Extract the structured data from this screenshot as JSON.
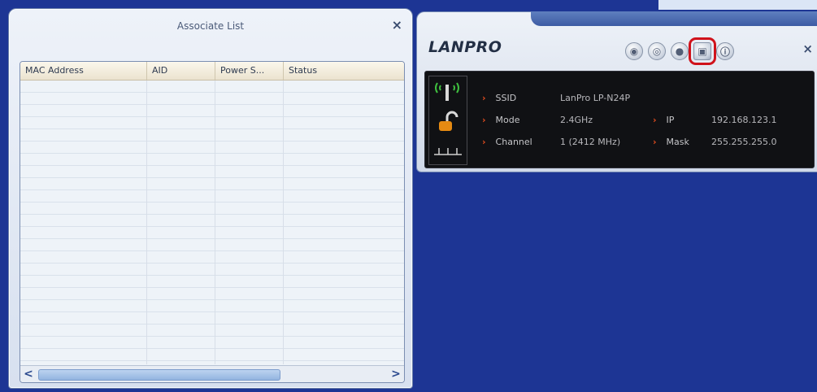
{
  "associate_list": {
    "title": "Associate List",
    "close": "×",
    "columns": [
      "MAC Address",
      "AID",
      "Power S...",
      "Status"
    ],
    "scroll_left": "<",
    "scroll_right": ">"
  },
  "utility": {
    "logo": "LANPRO",
    "close": "×",
    "toolbar": [
      {
        "name": "station-mode-icon",
        "glyph": "◉"
      },
      {
        "name": "settings-icon",
        "glyph": "◎"
      },
      {
        "name": "wps-icon",
        "glyph": "●"
      },
      {
        "name": "ap-mode-icon",
        "glyph": "▣"
      },
      {
        "name": "about-icon",
        "glyph": "ⓘ"
      }
    ],
    "active_tool": "ap-mode-icon",
    "info": {
      "ssid_label": "SSID",
      "ssid_value": "LanPro LP-N24P",
      "mode_label": "Mode",
      "mode_value": "2.4GHz",
      "channel_label": "Channel",
      "channel_value": "1 (2412 MHz)",
      "ip_label": "IP",
      "ip_value": "192.168.123.1",
      "mask_label": "Mask",
      "mask_value": "255.255.255.0"
    }
  },
  "colors": {
    "desktop": "#1d3594",
    "accent_arrow": "#e44d1e",
    "highlight": "#d0121b"
  }
}
